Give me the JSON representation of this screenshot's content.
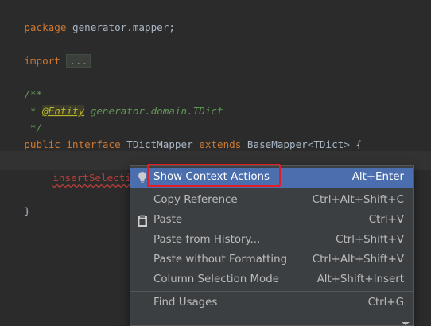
{
  "editor": {
    "line1": {
      "kw": "package",
      "rest": " generator.mapper;"
    },
    "line2": {
      "kw": "import",
      "fold": "..."
    },
    "line3": {
      "open": "/**"
    },
    "line4": {
      "star": " * ",
      "anno": "@Entity",
      "ref": " generator.domain.TDict"
    },
    "line5": {
      "close": " */"
    },
    "line6": {
      "kw1": "public",
      "kw2": "interface",
      "name": " TDictMapper ",
      "kw3": "extends",
      "rest": " BaseMapper<TDict> {"
    },
    "line7": {
      "method": "insertSelective"
    },
    "line8": {
      "brace": "}"
    }
  },
  "context_menu": {
    "items": [
      {
        "label": "Show Context Actions",
        "shortcut": "Alt+Enter",
        "icon": "lightbulb-icon",
        "selected": true
      },
      {
        "label": "Copy Reference",
        "shortcut": "Ctrl+Alt+Shift+C"
      },
      {
        "label": "Paste",
        "shortcut": "Ctrl+V",
        "icon": "clipboard-icon"
      },
      {
        "label": "Paste from History...",
        "shortcut": "Ctrl+Shift+V"
      },
      {
        "label": "Paste without Formatting",
        "shortcut": "Ctrl+Alt+Shift+V"
      },
      {
        "label": "Column Selection Mode",
        "shortcut": "Alt+Shift+Insert"
      },
      {
        "label": "Find Usages",
        "shortcut": "Ctrl+G"
      }
    ]
  },
  "colors": {
    "background": "#2b2b2b",
    "keyword": "#cc7832",
    "doc_comment": "#629755",
    "annotation": "#bbb529",
    "error": "#bc3f3c",
    "menu_background": "#3c3f41",
    "menu_selected": "#4b6eaf",
    "highlight_box": "#e51c23"
  }
}
